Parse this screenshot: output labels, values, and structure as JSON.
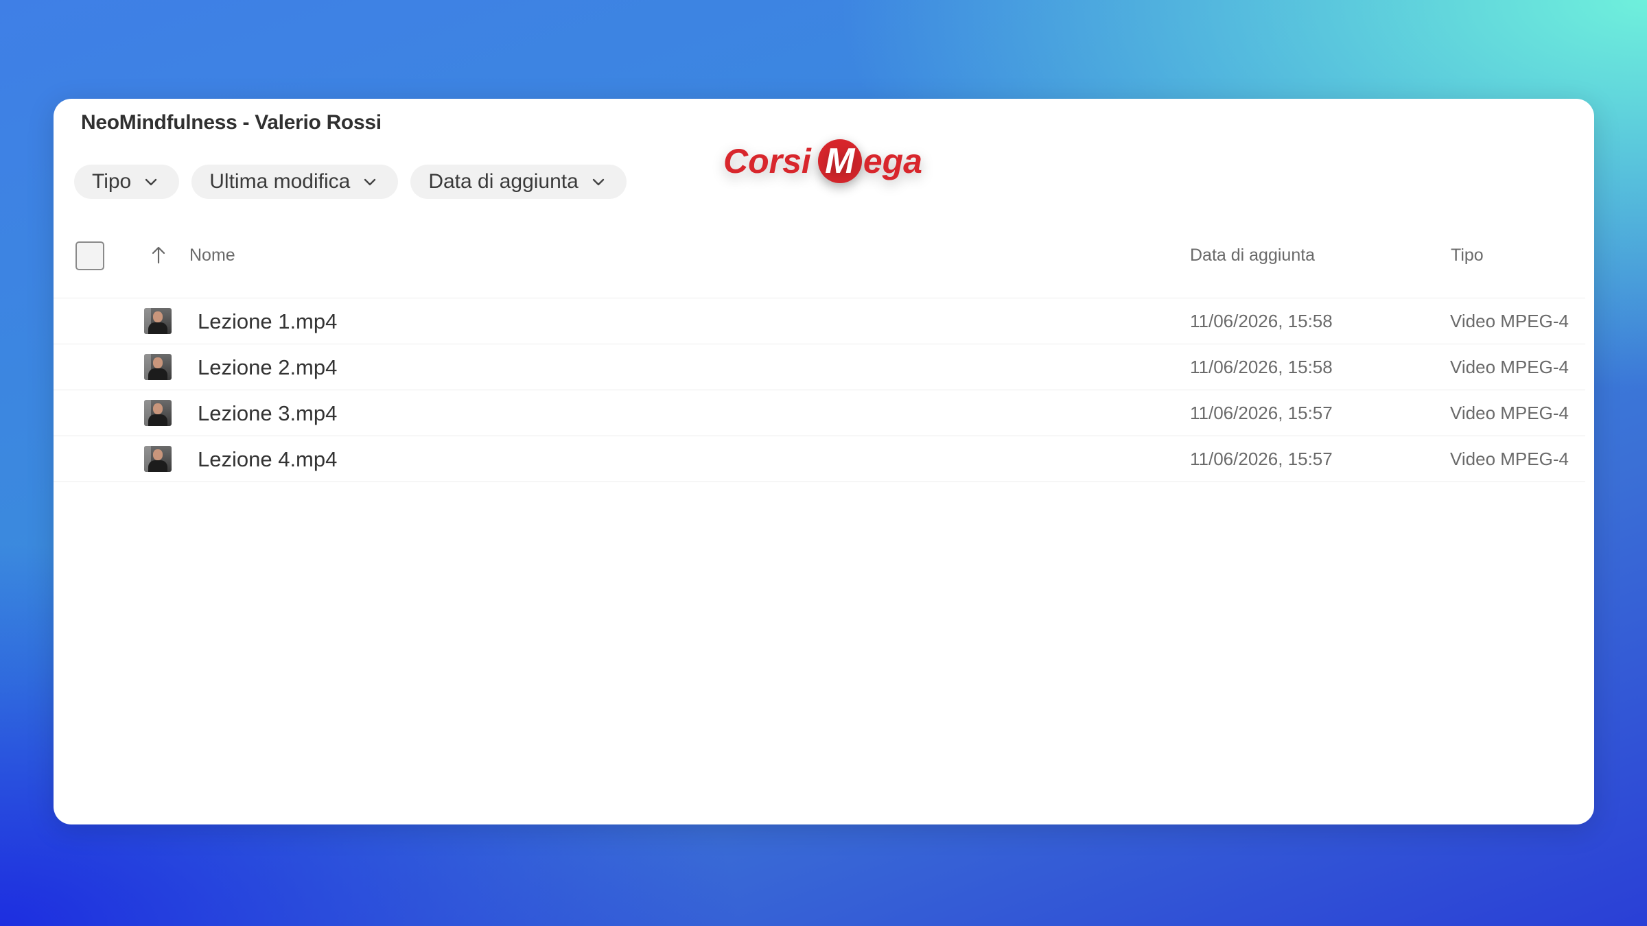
{
  "folder": {
    "title": "NeoMindfulness - Valerio Rossi"
  },
  "logo": {
    "text_left": "Corsi",
    "letter_m": "M",
    "text_right": "ega",
    "color": "#d8262c"
  },
  "filters": [
    {
      "label": "Tipo",
      "icon": "chevron-down-icon"
    },
    {
      "label": "Ultima modifica",
      "icon": "chevron-down-icon"
    },
    {
      "label": "Data di aggiunta",
      "icon": "chevron-down-icon"
    }
  ],
  "table": {
    "columns": {
      "name": "Nome",
      "date_added": "Data di aggiunta",
      "type": "Tipo"
    },
    "sort_icon": "arrow-up-icon",
    "rows": [
      {
        "name": "Lezione 1.mp4",
        "date_added": "11/06/2026, 15:58",
        "type": "Video MPEG-4",
        "icon": "video-thumbnail"
      },
      {
        "name": "Lezione 2.mp4",
        "date_added": "11/06/2026, 15:58",
        "type": "Video MPEG-4",
        "icon": "video-thumbnail"
      },
      {
        "name": "Lezione 3.mp4",
        "date_added": "11/06/2026, 15:57",
        "type": "Video MPEG-4",
        "icon": "video-thumbnail"
      },
      {
        "name": "Lezione 4.mp4",
        "date_added": "11/06/2026, 15:57",
        "type": "Video MPEG-4",
        "icon": "video-thumbnail"
      }
    ]
  }
}
